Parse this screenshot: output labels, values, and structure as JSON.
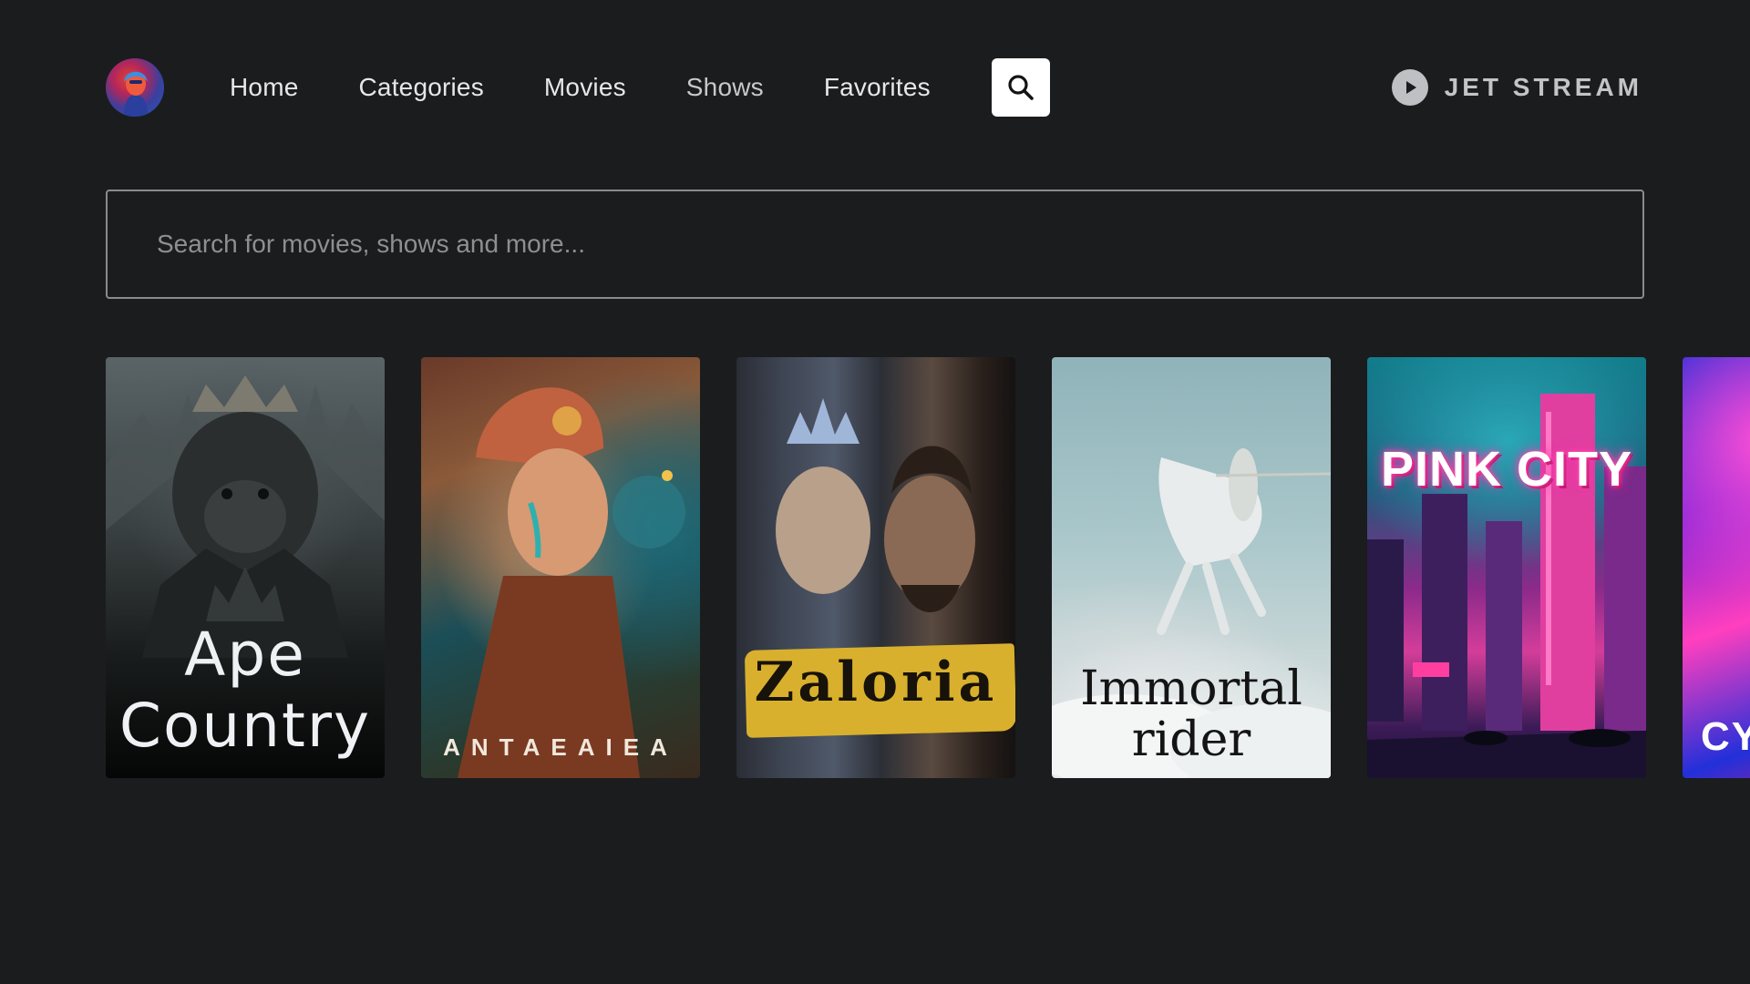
{
  "app": {
    "brand_name": "JET STREAM"
  },
  "nav": {
    "items": [
      {
        "label": "Home"
      },
      {
        "label": "Categories"
      },
      {
        "label": "Movies"
      },
      {
        "label": "Shows"
      },
      {
        "label": "Favorites"
      }
    ]
  },
  "search": {
    "placeholder": "Search for movies, shows and more...",
    "value": ""
  },
  "posters": [
    {
      "title": "Ape\nCountry"
    },
    {
      "title": "ANTAEAIEA"
    },
    {
      "title": "Zaloria"
    },
    {
      "title": "Immortal\nrider"
    },
    {
      "title": "PINK CITY"
    },
    {
      "title": "CY"
    }
  ],
  "icons": {
    "search": "search-icon",
    "brand": "play-circle-icon",
    "avatar": "user-avatar"
  },
  "colors": {
    "background": "#1b1c1e",
    "nav_text": "#e7e7e9",
    "search_button_bg": "#ffffff",
    "brand_text": "#c3c4c7",
    "field_border": "#8a8b8f"
  }
}
